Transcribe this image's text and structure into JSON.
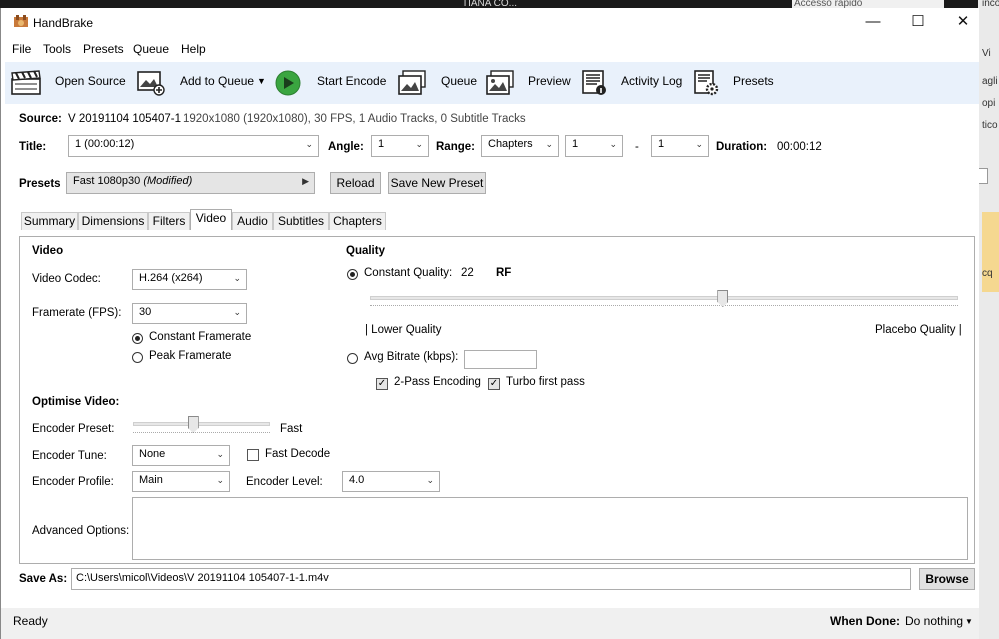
{
  "background": {
    "taskbar_text": "TIANA CO...",
    "explorer_text": "Accesso rapido",
    "right_texts": [
      "inco",
      "Vi",
      "agli",
      "opi",
      "tico",
      "cq"
    ]
  },
  "window": {
    "title": "HandBrake",
    "minimize": "—",
    "maximize": "☐",
    "close": "✕"
  },
  "menu": [
    "File",
    "Tools",
    "Presets",
    "Queue",
    "Help"
  ],
  "toolbar": {
    "open_source": "Open Source",
    "add_to_queue": "Add to Queue",
    "start_encode": "Start Encode",
    "queue": "Queue",
    "preview": "Preview",
    "activity_log": "Activity Log",
    "presets": "Presets"
  },
  "source": {
    "label": "Source:",
    "name": "V 20191104 105407-1",
    "info": "1920x1080 (1920x1080), 30 FPS, 1 Audio Tracks, 0 Subtitle Tracks"
  },
  "title_row": {
    "title_label": "Title:",
    "title_value": "1 (00:00:12)",
    "angle_label": "Angle:",
    "angle_value": "1",
    "range_label": "Range:",
    "range_value": "Chapters",
    "range_start": "1",
    "range_sep": "-",
    "range_end": "1",
    "duration_label": "Duration:",
    "duration_value": "00:00:12"
  },
  "presets_row": {
    "label": "Presets",
    "value": "Fast 1080p30",
    "modified": "(Modified)",
    "reload": "Reload",
    "save_new": "Save New Preset"
  },
  "tabs": [
    "Summary",
    "Dimensions",
    "Filters",
    "Video",
    "Audio",
    "Subtitles",
    "Chapters"
  ],
  "active_tab": "Video",
  "video": {
    "section": "Video",
    "codec_label": "Video Codec:",
    "codec_value": "H.264 (x264)",
    "fps_label": "Framerate (FPS):",
    "fps_value": "30",
    "constant_framerate": "Constant Framerate",
    "peak_framerate": "Peak Framerate"
  },
  "quality": {
    "section": "Quality",
    "constant_label": "Constant Quality:",
    "constant_value": "22",
    "unit": "RF",
    "slider_fraction": 0.6,
    "lower": "| Lower Quality",
    "placebo": "Placebo Quality |",
    "avg_label": "Avg Bitrate (kbps):",
    "avg_value": "",
    "two_pass": "2-Pass Encoding",
    "turbo": "Turbo first pass"
  },
  "optimise": {
    "section": "Optimise Video:",
    "preset_label": "Encoder Preset:",
    "preset_value": "Fast",
    "preset_fraction": 0.44,
    "tune_label": "Encoder Tune:",
    "tune_value": "None",
    "fast_decode": "Fast Decode",
    "profile_label": "Encoder Profile:",
    "profile_value": "Main",
    "level_label": "Encoder Level:",
    "level_value": "4.0",
    "advanced_label": "Advanced Options:",
    "advanced_value": ""
  },
  "save_as": {
    "label": "Save As:",
    "path": "C:\\Users\\micol\\Videos\\V 20191104 105407-1-1.m4v",
    "browse": "Browse"
  },
  "status": {
    "text": "Ready",
    "when_done_label": "When Done:",
    "when_done_value": "Do nothing"
  }
}
